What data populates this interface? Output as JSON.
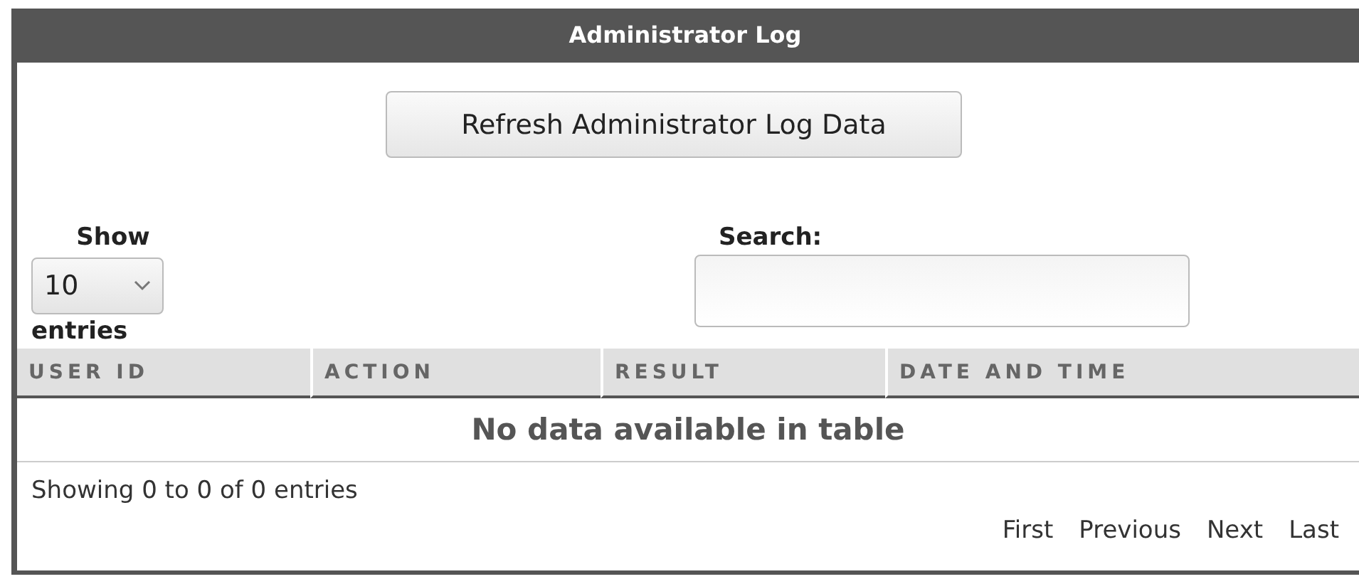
{
  "panel": {
    "title": "Administrator Log"
  },
  "refresh_button": {
    "label": "Refresh Administrator Log Data"
  },
  "length_control": {
    "label_before": "Show",
    "value": "10",
    "label_after": "entries"
  },
  "search": {
    "label": "Search:"
  },
  "table": {
    "columns": [
      "USER ID",
      "ACTION",
      "RESULT",
      "DATE AND TIME"
    ],
    "empty_message": "No data available in table"
  },
  "info": "Showing 0 to 0 of 0 entries",
  "pagination": [
    {
      "label": "First"
    },
    {
      "label": "Previous"
    },
    {
      "label": "Next"
    },
    {
      "label": "Last"
    }
  ]
}
